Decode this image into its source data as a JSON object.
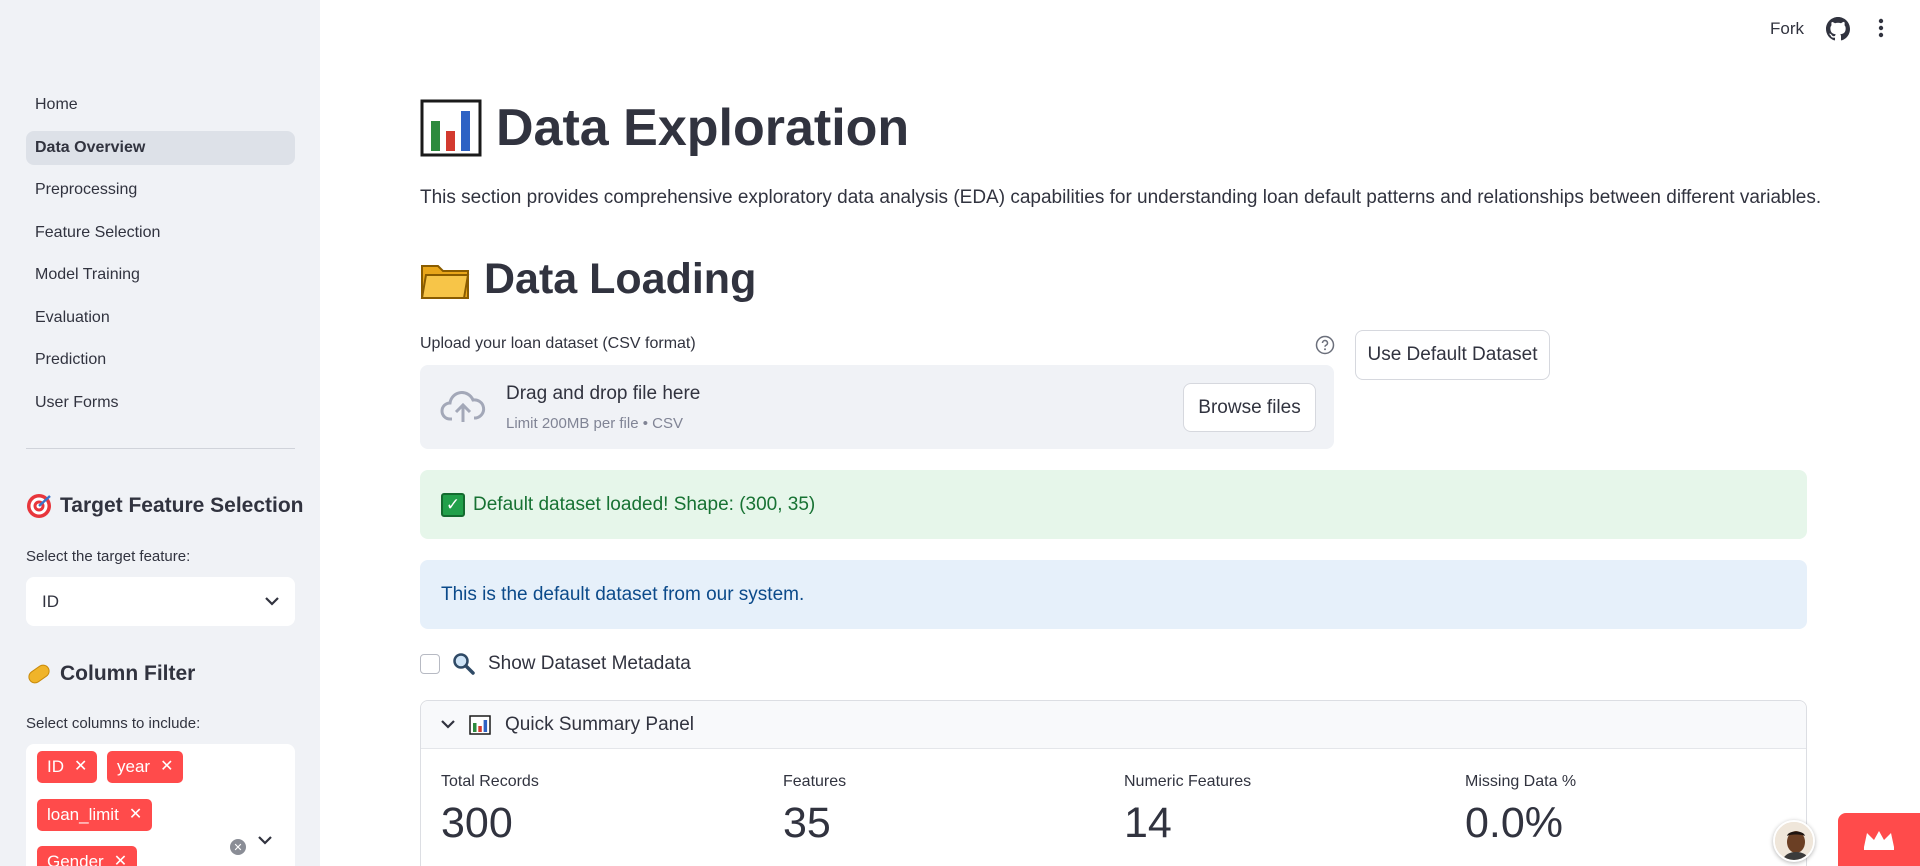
{
  "sidebar": {
    "nav": [
      "Home",
      "Data Overview",
      "Preprocessing",
      "Feature Selection",
      "Model Training",
      "Evaluation",
      "Prediction",
      "User Forms"
    ],
    "active_index": 1,
    "target_heading": "Target Feature Selection",
    "target_label": "Select the target feature:",
    "target_value": "ID",
    "filter_heading": "Column Filter",
    "filter_label": "Select columns to include:",
    "filter_tags": [
      "ID",
      "year",
      "loan_limit",
      "Gender"
    ]
  },
  "header": {
    "fork": "Fork",
    "icons": [
      "github-icon",
      "kebab-menu-icon"
    ]
  },
  "main": {
    "title": "Data Exploration",
    "intro": "This section provides comprehensive exploratory data analysis (EDA) capabilities for understanding loan default patterns and relationships between different variables.",
    "section_title": "Data Loading",
    "upload_label": "Upload your loan dataset (CSV format)",
    "dropzone_main": "Drag and drop file here",
    "dropzone_sub": "Limit 200MB per file • CSV",
    "browse_label": "Browse files",
    "default_button": "Use Default Dataset",
    "success_message": "Default dataset loaded! Shape: (300, 35)",
    "info_message": "This is the default dataset from our system.",
    "metadata_checkbox": "Show Dataset Metadata",
    "summary_title": "Quick Summary Panel",
    "metrics": [
      {
        "label": "Total Records",
        "value": "300"
      },
      {
        "label": "Features",
        "value": "35"
      },
      {
        "label": "Numeric Features",
        "value": "14"
      },
      {
        "label": "Missing Data %",
        "value": "0.0%"
      }
    ]
  },
  "colors": {
    "accent": "#ff4b4b",
    "sidebar_bg": "#f0f2f6",
    "success_bg": "#e6f6ea",
    "info_bg": "#e6f0fa"
  }
}
